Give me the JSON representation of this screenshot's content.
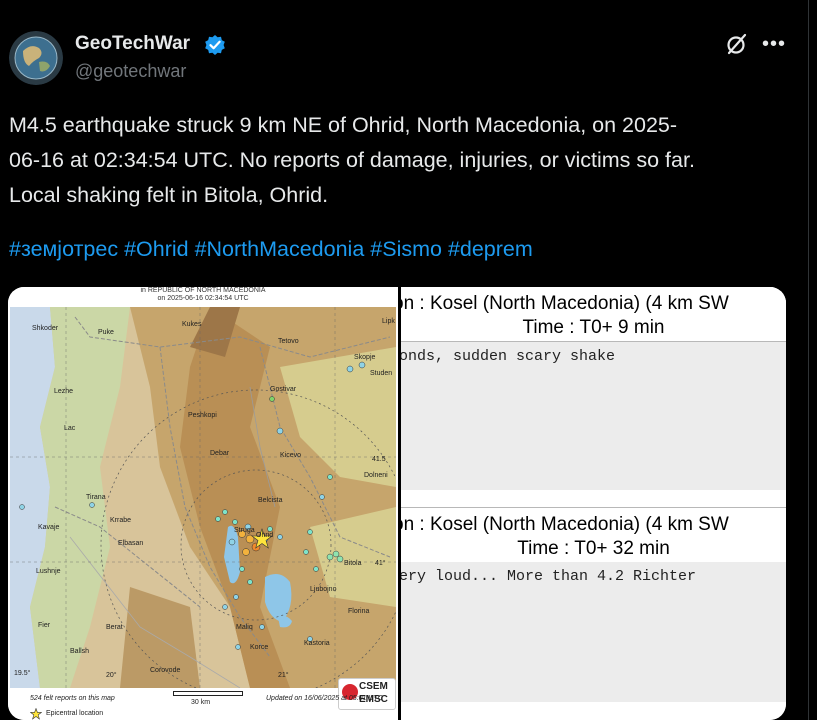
{
  "post": {
    "author_name": "GeoTechWar",
    "author_handle": "@geotechwar",
    "text_line1": "M4.5 earthquake struck 9 km NE of Ohrid, North Macedonia, on 2025-",
    "text_line2": "06-16 at 02:34:54 UTC. No reports of damage, injuries, or victims so far.",
    "text_line3": "Local shaking felt in Bitola, Ohrid.",
    "hashtags": [
      "#земјотрес",
      "#Ohrid",
      "#NorthMacedonia",
      "#Sismo",
      "#deprem"
    ]
  },
  "icons": {
    "verified": "verified-badge-icon",
    "grok": "grok-icon",
    "more": "more-options-icon"
  },
  "colors": {
    "background": "#000000",
    "text": "#e7e9ea",
    "secondary_text": "#71767b",
    "link": "#1d9bf0",
    "verified": "#1d9bf0"
  },
  "map": {
    "title_line1": "in REPUBLIC OF NORTH MACEDONIA",
    "title_line2": "on  2025-06-16 02:34:54 UTC",
    "places": [
      {
        "name": "Shkoder"
      },
      {
        "name": "Puke"
      },
      {
        "name": "Kukes"
      },
      {
        "name": "Tetovo"
      },
      {
        "name": "Skopje"
      },
      {
        "name": "Studen"
      },
      {
        "name": "Lezhe"
      },
      {
        "name": "Gostivar"
      },
      {
        "name": "Lac"
      },
      {
        "name": "Peshkopi"
      },
      {
        "name": "Debar"
      },
      {
        "name": "Kicevo"
      },
      {
        "name": "Dolneni"
      },
      {
        "name": "Tirana"
      },
      {
        "name": "Kavaje"
      },
      {
        "name": "Krrabe"
      },
      {
        "name": "Elbasan"
      },
      {
        "name": "Belcista"
      },
      {
        "name": "Struga"
      },
      {
        "name": "Ohrid"
      },
      {
        "name": "Bitola"
      },
      {
        "name": "Lushnje"
      },
      {
        "name": "Ljubojno"
      },
      {
        "name": "Fier"
      },
      {
        "name": "Berat"
      },
      {
        "name": "Maliq"
      },
      {
        "name": "Florina"
      },
      {
        "name": "Korce"
      },
      {
        "name": "Kastoria"
      },
      {
        "name": "Ballsh"
      },
      {
        "name": "Corovode"
      },
      {
        "name": "Lipk"
      }
    ],
    "lat_labels": [
      "41.5",
      "41"
    ],
    "lon_labels": [
      "19.5",
      "20",
      "21"
    ],
    "scale_label": "30 km",
    "felt_reports": "524 felt reports on this map",
    "legend_epicenter": "Epicentral location",
    "updated": "Updated on 16/06/2025 at 05:01 UTC",
    "logo_line1": "CSEM",
    "logo_line2": "EMSC"
  },
  "reports": [
    {
      "location": "on : Kosel (North Macedonia) (4 km SW",
      "time": "Time : T0+ 9 min",
      "comment": "onds, sudden scary shake"
    },
    {
      "location": "on : Kosel (North Macedonia) (4 km SW",
      "time": "Time : T0+ 32 min",
      "comment": "ery loud... More than 4.2 Richter"
    }
  ]
}
